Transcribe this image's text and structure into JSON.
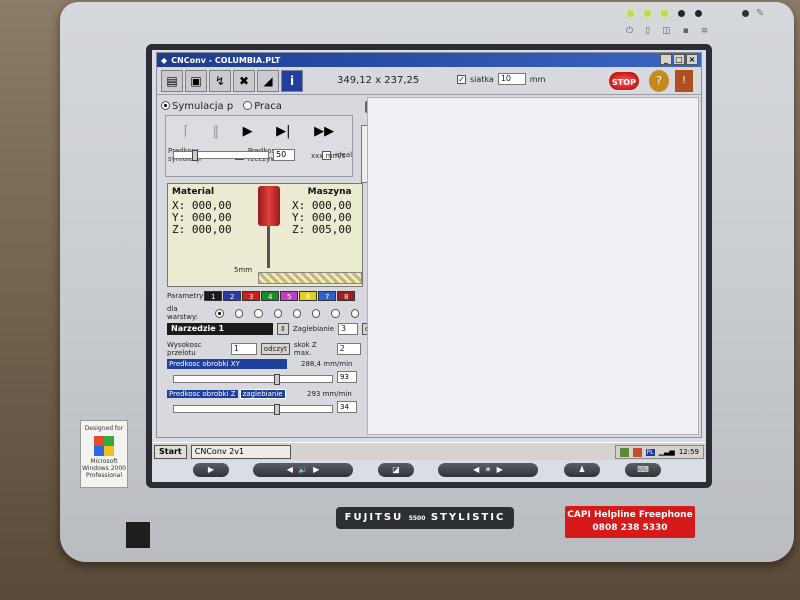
{
  "window": {
    "title": "CNConv - COLUMBIA.PLT",
    "controls": [
      "_",
      "□",
      "×"
    ]
  },
  "toolbar": {
    "coords": "349,12 x 237,25",
    "siatka_label": "siatka",
    "siatka_checked": true,
    "siatka_value": "10",
    "siatka_unit": "mm",
    "stop_label": "STOP",
    "help_symbol": "?",
    "exit_symbol": "!"
  },
  "mode": {
    "simulation_label": "Symulacja p",
    "work_label": "Praca",
    "selected": "simulation"
  },
  "playback": {
    "speed_label": "Predkosc symulacji",
    "real_speed_label": "Predkosc rzeczywista",
    "real_speed_checked": true,
    "ideal_label": "ideal",
    "ideal_checked": false,
    "speed_value": "50",
    "speed_unit": "xxx mm/s",
    "speed_fraction": 0.2
  },
  "readout": {
    "material_label": "Material",
    "machine_label": "Maszyna",
    "material": {
      "x": "X: 000,00",
      "y": "Y: 000,00",
      "z": "Z: 000,00"
    },
    "machine": {
      "x": "X: 000,00",
      "y": "Y: 000,00",
      "z": "Z: 005,00"
    },
    "scale_label": "5mm"
  },
  "parameters": {
    "label": "Parametry",
    "layers_label": "dla warstwy:",
    "cells": [
      {
        "n": "1",
        "color": "#1a1a1a"
      },
      {
        "n": "2",
        "color": "#2a3aa8"
      },
      {
        "n": "3",
        "color": "#d11a1a"
      },
      {
        "n": "4",
        "color": "#1a8a2a"
      },
      {
        "n": "5",
        "color": "#c33ac3"
      },
      {
        "n": "6",
        "color": "#e0d020"
      },
      {
        "n": "7",
        "color": "#2a60d0"
      },
      {
        "n": "8",
        "color": "#a02020"
      }
    ]
  },
  "tool_settings": {
    "tool_name": "Narzedzie 1",
    "plunge_label": "Zaglebianie",
    "plunge_value": "3",
    "plunge_btn": "od",
    "height_label": "Wysokosc przelotu",
    "height_value": "1",
    "read_btn": "odczyt",
    "zstep_label": "skok Z max.",
    "zstep_value": "2",
    "xy_speed_label": "Predkosc obrobki XY",
    "xy_speed_rate": "288,4 mm/min",
    "xy_speed_value": "93",
    "xy_fraction": 0.66,
    "z_speed_label": "Predkosc obrobki Z",
    "z_plunge_label": "zaglebianie",
    "z_speed_rate": "293 mm/min",
    "z_speed_value": "34",
    "z_fraction": 0.66
  },
  "taskbar": {
    "start_label": "Start",
    "task_label": "CNConv 2v1",
    "clock": "12:59",
    "lang": "PL"
  },
  "device": {
    "badge_line1": "Designed for",
    "badge_line2": "Microsoft",
    "badge_line3": "Windows 2000",
    "badge_line4": "Professional",
    "brand": "FUJITSU",
    "brand_model": "5500",
    "brand_series": "STYLISTIC",
    "helpline_line1": "CAPI Helpline Freephone",
    "helpline_line2": "0808 238 5330"
  }
}
